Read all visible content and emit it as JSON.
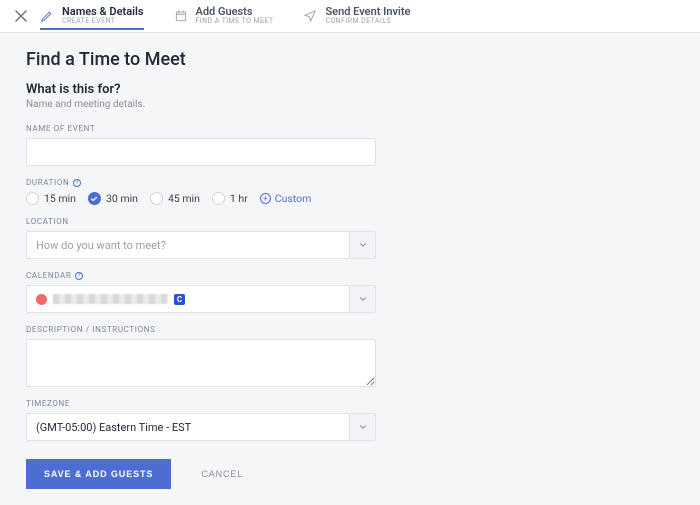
{
  "steps": [
    {
      "title": "Names & Details",
      "sub": "CREATE EVENT"
    },
    {
      "title": "Add Guests",
      "sub": "FIND A TIME TO MEET"
    },
    {
      "title": "Send Event Invite",
      "sub": "CONFIRM DETAILS"
    }
  ],
  "page_title": "Find a Time to Meet",
  "section_title": "What is this for?",
  "section_sub": "Name and meeting details.",
  "labels": {
    "name_of_event": "NAME OF EVENT",
    "duration": "DURATION",
    "location": "LOCATION",
    "calendar": "CALENDAR",
    "description": "DESCRIPTION / INSTRUCTIONS",
    "timezone": "TIMEZONE"
  },
  "duration": {
    "options": [
      "15 min",
      "30 min",
      "45 min",
      "1 hr"
    ],
    "selected": "30 min",
    "custom": "Custom"
  },
  "location": {
    "placeholder": "How do you want to meet?"
  },
  "calendar": {
    "badge": "C",
    "color": "#f26a63"
  },
  "timezone": {
    "value": "(GMT-05:00) Eastern Time - EST"
  },
  "actions": {
    "save": "SAVE & ADD GUESTS",
    "cancel": "CANCEL"
  }
}
